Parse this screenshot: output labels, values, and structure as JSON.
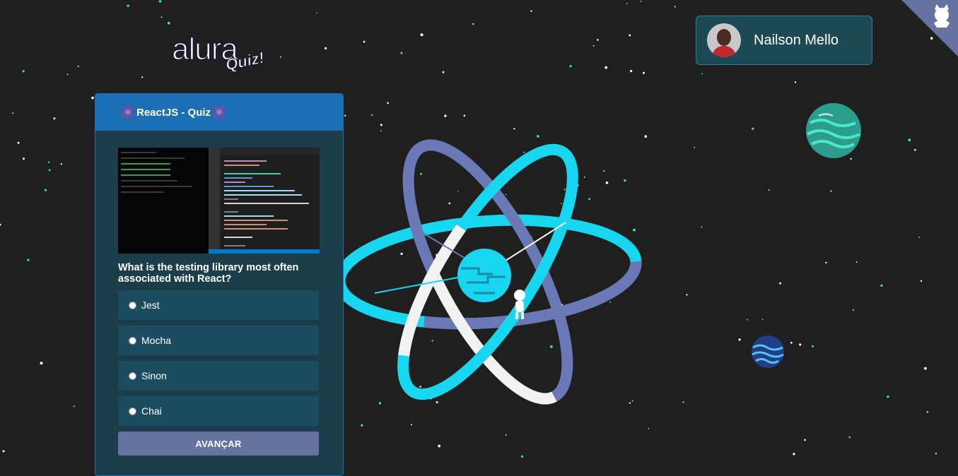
{
  "brand": {
    "logo_main": "alura",
    "logo_sub": "Quiz!"
  },
  "quiz": {
    "title": "ReactJS - Quiz",
    "title_icon": "react-atom-icon",
    "question": "What is the testing library most often associated with React?",
    "answers": [
      {
        "label": "Jest"
      },
      {
        "label": "Mocha"
      },
      {
        "label": "Sinon"
      },
      {
        "label": "Chai"
      }
    ],
    "submit_label": "AVANÇAR"
  },
  "profile": {
    "name": "Nailson Mello"
  },
  "colors": {
    "background": "#1f1f1f",
    "card_header": "#1a6fb5",
    "card_body": "#1c3e4a",
    "answer_bg": "#1c4c60",
    "button_bg": "#6672a0",
    "accent_cyan": "#17d7f0"
  },
  "icons": [
    "react-atom-icon",
    "github-corner-icon",
    "avatar",
    "code-screenshot"
  ]
}
